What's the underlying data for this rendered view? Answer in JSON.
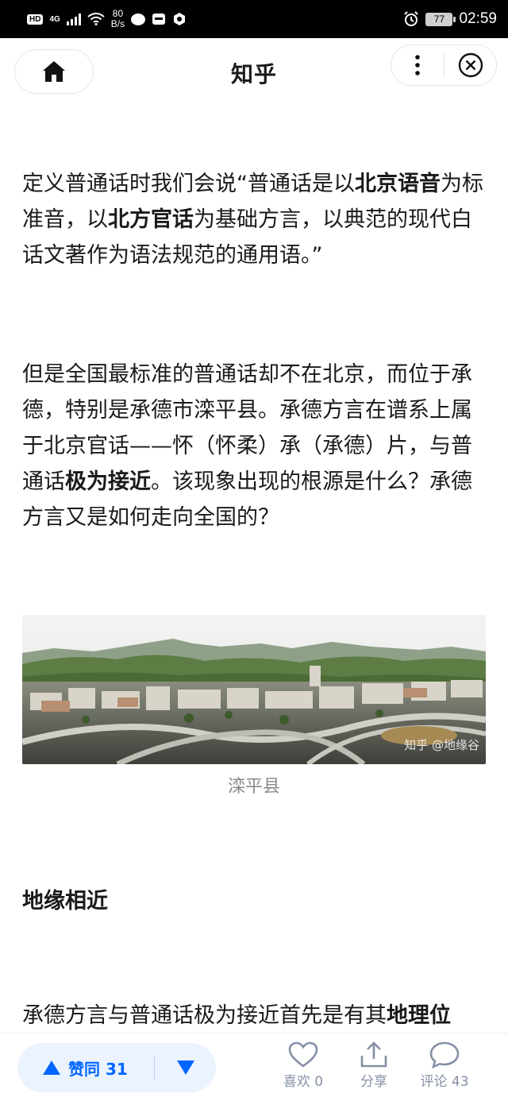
{
  "status_bar": {
    "hd": "HD",
    "net": "4G",
    "speed_top": "80",
    "speed_bottom": "B/s",
    "battery": "77",
    "time": "02:59"
  },
  "header": {
    "title": "知乎"
  },
  "article": {
    "p1": [
      {
        "t": "定义普通话时我们会说“普通话是以",
        "b": false
      },
      {
        "t": "北京语音",
        "b": true
      },
      {
        "t": "为标准音，以",
        "b": false
      },
      {
        "t": "北方官话",
        "b": true
      },
      {
        "t": "为基础方言，以典范的现代白话文著作为语法规范的通用语。”",
        "b": false
      }
    ],
    "p2": [
      {
        "t": "但是全国最标准的普通话却不在北京，而位于承德，特别是承德市滦平县。承德方言在谱系上属于北京官话——怀（怀柔）承（承德）片，与普通话",
        "b": false
      },
      {
        "t": "极为接近",
        "b": true
      },
      {
        "t": "。该现象出现的根源是什么？承德方言又是如何走向全国的？",
        "b": false
      }
    ],
    "image_watermark": "知乎 @地缘谷",
    "caption": "滦平县",
    "heading": "地缘相近",
    "p3": [
      {
        "t": "承德方言与普通话极为接近首先是有其",
        "b": false
      },
      {
        "t": "地理位",
        "b": true
      }
    ]
  },
  "bottom_bar": {
    "upvote_label": "赞同 31",
    "like_label": "喜欢 0",
    "share_label": "分享",
    "comment_label": "评论 43"
  },
  "colors": {
    "accent": "#0066ff",
    "vote_bg": "#ebf3ff",
    "icon_gray": "#8590a6"
  }
}
